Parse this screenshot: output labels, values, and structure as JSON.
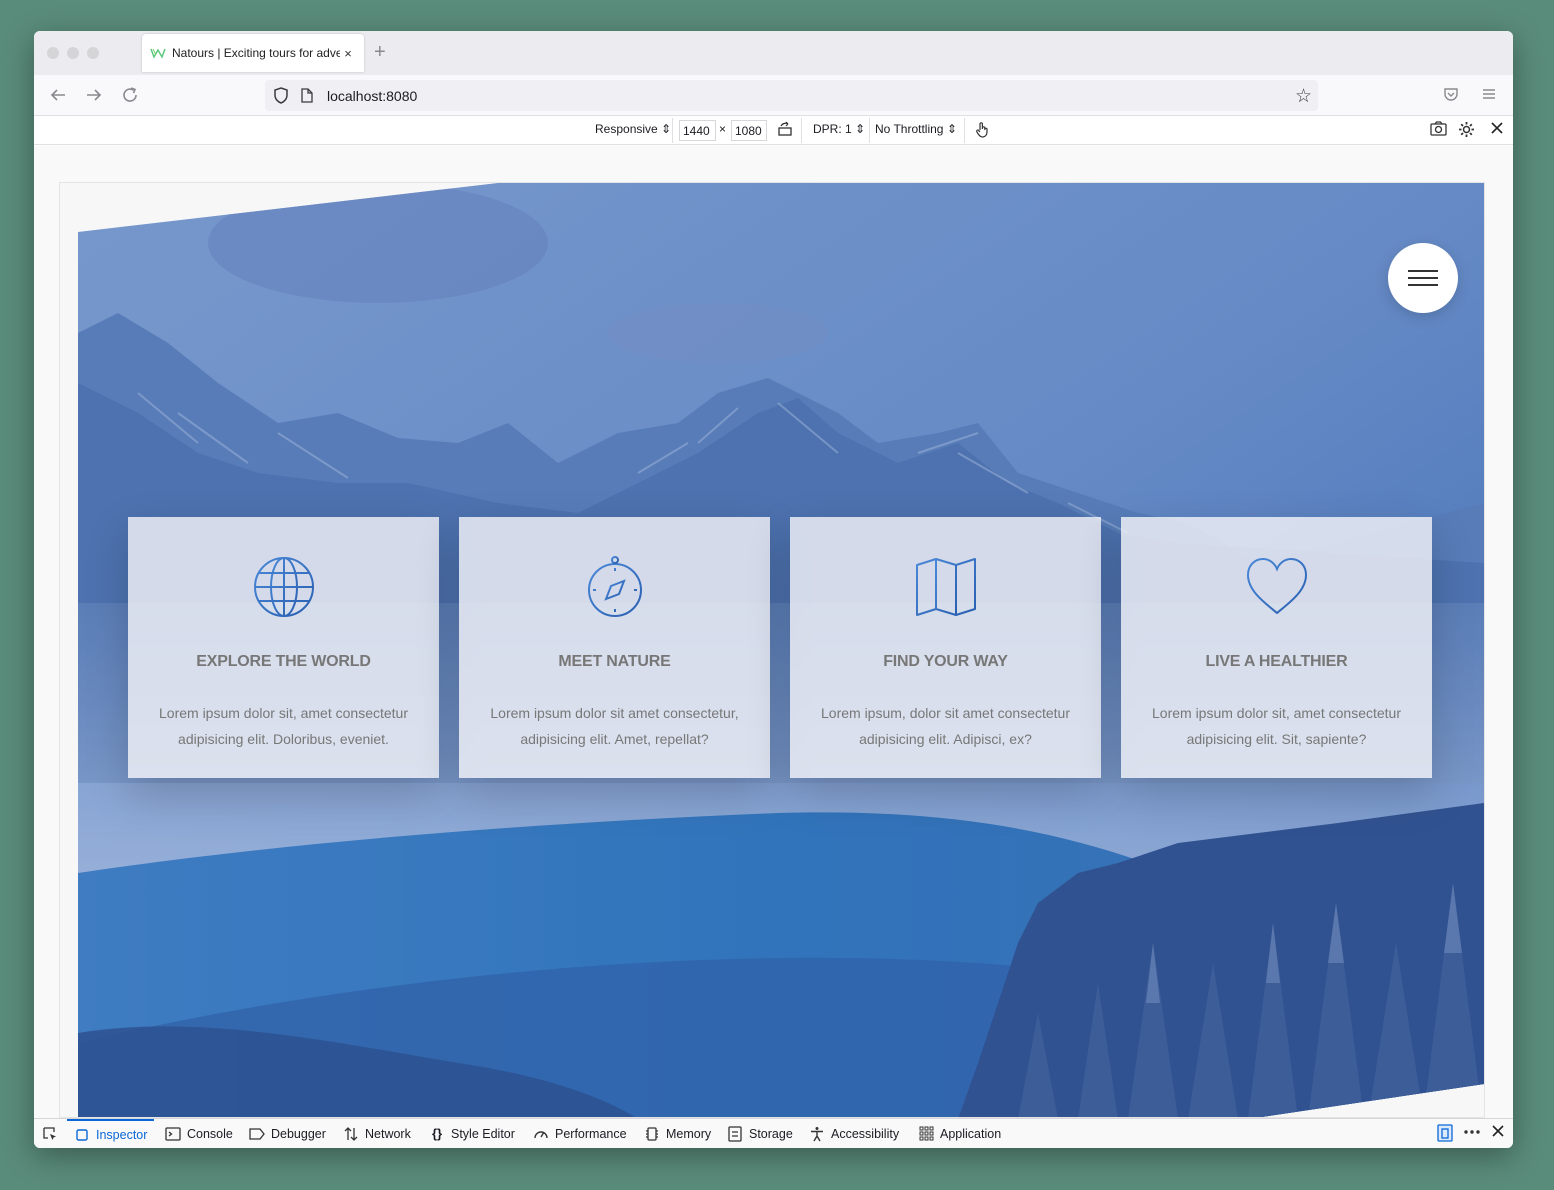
{
  "browser": {
    "tab_title": "Natours | Exciting tours for adve",
    "tab_close": "×",
    "new_tab": "+",
    "url": "localhost:8080"
  },
  "rdm": {
    "device": "Responsive",
    "width": "1440",
    "times": "×",
    "height": "1080",
    "dpr": "DPR: 1",
    "throttling": "No Throttling"
  },
  "features": [
    {
      "icon": "globe-icon",
      "title": "Explore the world",
      "text": "Lorem ipsum dolor sit, amet consectetur adipisicing elit. Doloribus, eveniet."
    },
    {
      "icon": "compass-icon",
      "title": "Meet nature",
      "text": "Lorem ipsum dolor sit amet consectetur, adipisicing elit. Amet, repellat?"
    },
    {
      "icon": "map-icon",
      "title": "Find your way",
      "text": "Lorem ipsum, dolor sit amet consectetur adipisicing elit. Adipisci, ex?"
    },
    {
      "icon": "heart-icon",
      "title": "Live a healthier",
      "text": "Lorem ipsum dolor sit, amet consectetur adipisicing elit. Sit, sapiente?"
    }
  ],
  "devtools": {
    "tabs": [
      "Inspector",
      "Console",
      "Debugger",
      "Network",
      "Style Editor",
      "Performance",
      "Memory",
      "Storage",
      "Accessibility",
      "Application"
    ],
    "active_tab": "Inspector"
  },
  "colors": {
    "accent": "#0a67d8",
    "icon_gradient_start": "#7ed56f",
    "icon_gradient_end": "#2998ff",
    "card_text": "#777777",
    "hero_overlay": "#3f6fb6"
  }
}
